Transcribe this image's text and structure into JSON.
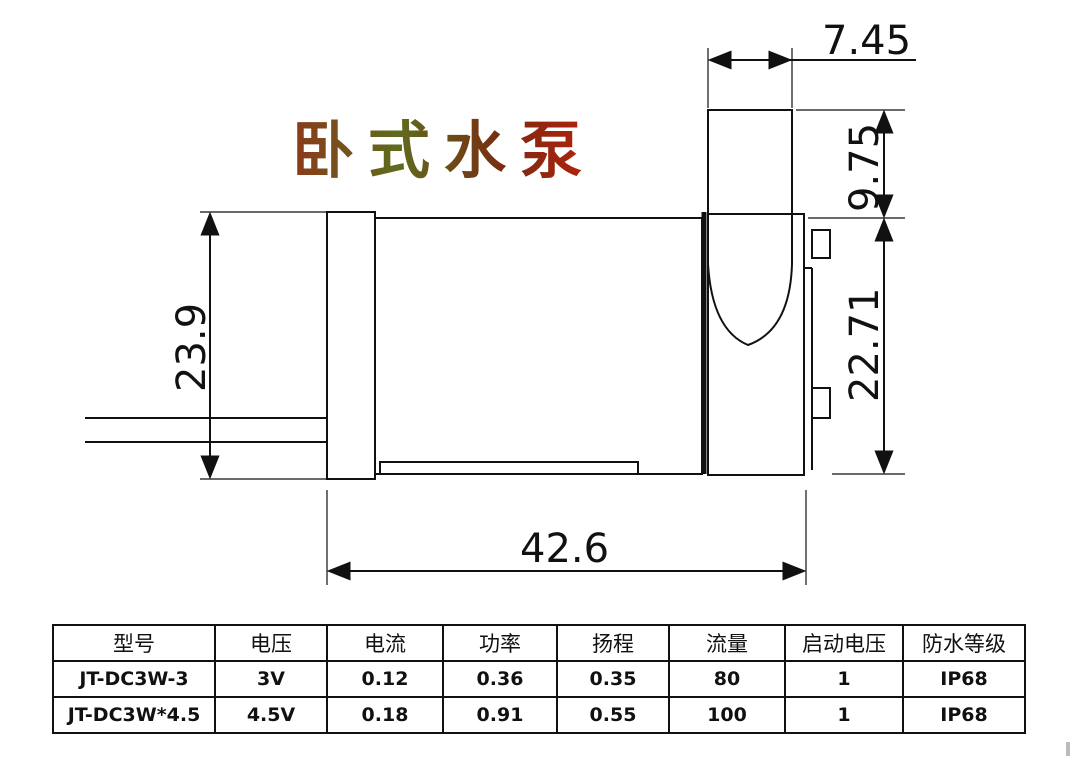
{
  "title": "卧式水泵",
  "dimensions": {
    "top_width": "7.45",
    "top_height": "9.75",
    "body_diameter": "23.9",
    "outlet_height": "22.71",
    "length": "42.6"
  },
  "spec_table": {
    "headers": [
      "型号",
      "电压",
      "电流",
      "功率",
      "扬程",
      "流量",
      "启动电压",
      "防水等级"
    ],
    "rows": [
      [
        "JT-DC3W-3",
        "3V",
        "0.12",
        "0.36",
        "0.35",
        "80",
        "1",
        "IP68"
      ],
      [
        "JT-DC3W*4.5",
        "4.5V",
        "0.18",
        "0.91",
        "0.55",
        "100",
        "1",
        "IP68"
      ]
    ]
  },
  "colors": {
    "line": "#111111",
    "title_gradient": [
      "#8a3a1c",
      "#5f6b1d",
      "#b8220e"
    ]
  }
}
